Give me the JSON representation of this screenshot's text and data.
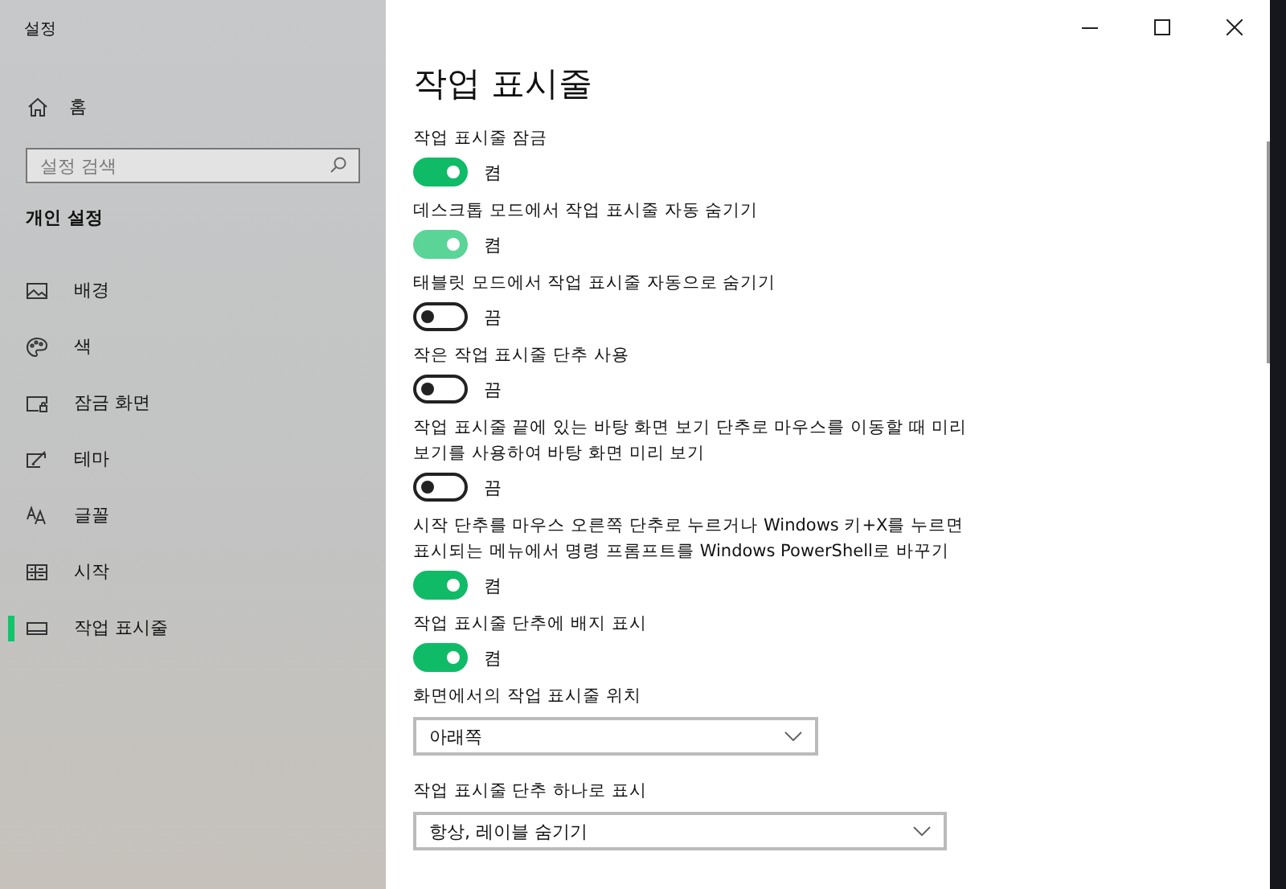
{
  "window": {
    "title": "설정"
  },
  "sidebar": {
    "home": "홈",
    "search": {
      "placeholder": "설정 검색"
    },
    "section": "개인 설정",
    "items": [
      {
        "label": "배경",
        "selected": false
      },
      {
        "label": "색",
        "selected": false
      },
      {
        "label": "잠금 화면",
        "selected": false
      },
      {
        "label": "테마",
        "selected": false
      },
      {
        "label": "글꼴",
        "selected": false
      },
      {
        "label": "시작",
        "selected": false
      },
      {
        "label": "작업 표시줄",
        "selected": true
      }
    ]
  },
  "page": {
    "title": "작업 표시줄",
    "settings": [
      {
        "kind": "toggle",
        "label": "작업 표시줄 잠금",
        "on": true,
        "hover": false,
        "state": "켬"
      },
      {
        "kind": "toggle",
        "label": "데스크톱 모드에서 작업 표시줄 자동 숨기기",
        "on": true,
        "hover": true,
        "state": "켬"
      },
      {
        "kind": "toggle",
        "label": "태블릿 모드에서 작업 표시줄 자동으로 숨기기",
        "on": false,
        "hover": false,
        "state": "끔"
      },
      {
        "kind": "toggle",
        "label": "작은 작업 표시줄 단추 사용",
        "on": false,
        "hover": false,
        "state": "끔"
      },
      {
        "kind": "toggle",
        "label": "작업 표시줄 끝에 있는 바탕 화면 보기 단추로 마우스를 이동할 때 미리 보기를 사용하여 바탕 화면 미리 보기",
        "on": false,
        "hover": false,
        "state": "끔"
      },
      {
        "kind": "toggle",
        "label": "시작 단추를 마우스 오른쪽 단추로 누르거나 Windows 키+X를 누르면 표시되는 메뉴에서 명령 프롬프트를 Windows PowerShell로 바꾸기",
        "on": true,
        "hover": false,
        "state": "켬"
      },
      {
        "kind": "toggle",
        "label": "작업 표시줄 단추에 배지 표시",
        "on": true,
        "hover": false,
        "state": "켬"
      },
      {
        "kind": "dropdown",
        "label": "화면에서의 작업 표시줄 위치",
        "value": "아래쪽",
        "wide": false
      },
      {
        "kind": "dropdown",
        "label": "작업 표시줄 단추 하나로 표시",
        "value": "항상, 레이블 숨기기",
        "wide": true
      }
    ]
  }
}
